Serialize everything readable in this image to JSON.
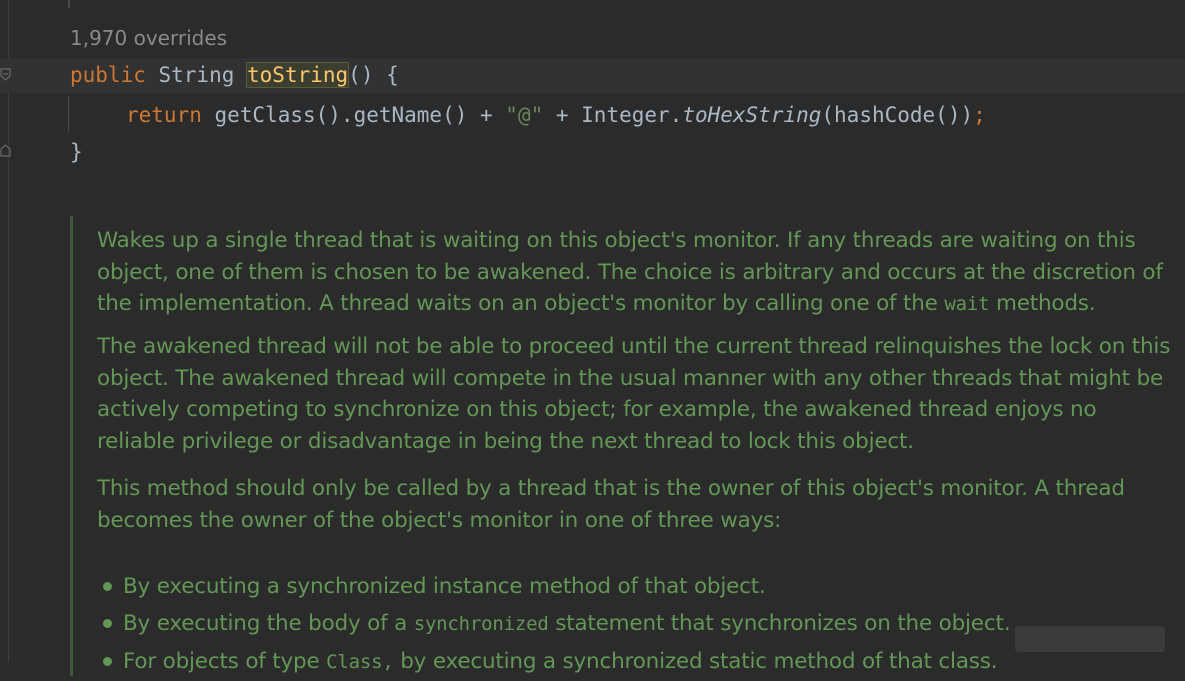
{
  "hint": {
    "overrides": "1,970 overrides"
  },
  "code": {
    "line1": {
      "kw": "public",
      "type": " String ",
      "method": "toString",
      "rest": "() {"
    },
    "line2": {
      "kw": "return",
      "a": " getClass().getName() + ",
      "str": "\"@\"",
      "b": " + Integer.",
      "italic": "toHexString",
      "c": "(hashCode())",
      "semi": ";"
    },
    "line3": "}"
  },
  "doc": {
    "p1a": "Wakes up a single thread that is waiting on this object's monitor. If any threads are waiting on this object, one of them is chosen to be awakened. The choice is arbitrary and occurs at the discretion of the implementation. A thread waits on an object's monitor by calling one of the ",
    "p1code": "wait",
    "p1b": " methods.",
    "p2": "The awakened thread will not be able to proceed until the current thread relinquishes the lock on this object. The awakened thread will compete in the usual manner with any other threads that might be actively competing to synchronize on this object; for example, the awakened thread enjoys no reliable privilege or disadvantage in being the next thread to lock this object.",
    "p3": "This method should only be called by a thread that is the owner of this object's monitor. A thread becomes the owner of the object's monitor in one of three ways:",
    "b1": "By executing a synchronized instance method of that object.",
    "b2a": "By executing the body of a ",
    "b2code": "synchronized",
    "b2b": " statement that synchronizes on the object.",
    "b3a": "For objects of type ",
    "b3code": "Class,",
    "b3b": " by executing a synchronized static method of that class."
  },
  "colors": {
    "keyword": "#cc7832",
    "method": "#ffc66d",
    "string": "#6a8759",
    "doc": "#629755",
    "text": "#a9b7c6",
    "background": "#2b2b2b"
  },
  "icons": [
    "fold-start-icon",
    "fold-end-icon"
  ]
}
